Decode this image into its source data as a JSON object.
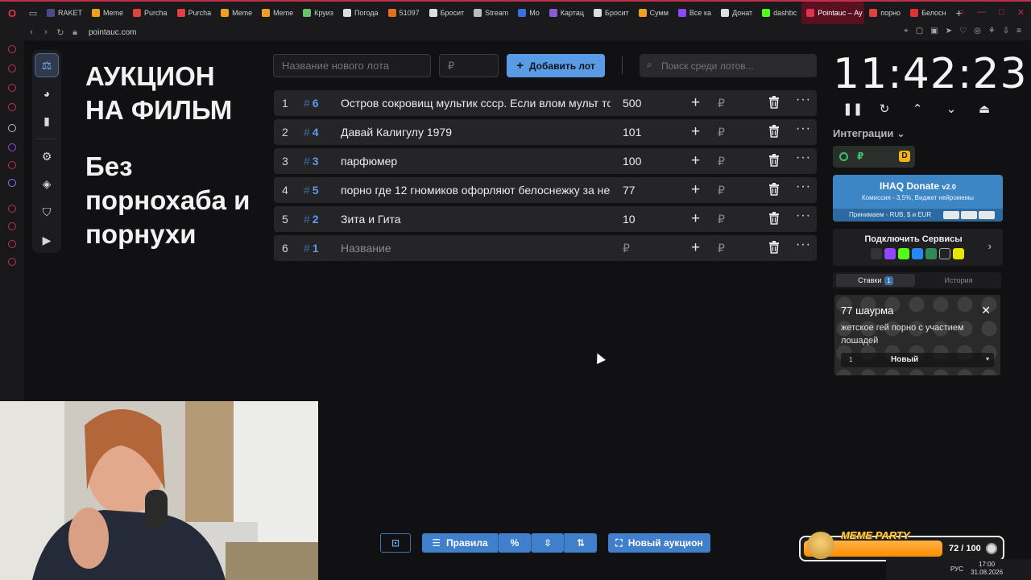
{
  "browser": {
    "tabs": [
      {
        "label": "RAKET",
        "color": "#4a4a8a"
      },
      {
        "label": "Meme",
        "color": "#f0a020"
      },
      {
        "label": "Purcha",
        "color": "#e04040"
      },
      {
        "label": "Purcha",
        "color": "#e04040"
      },
      {
        "label": "Meme",
        "color": "#f0a020"
      },
      {
        "label": "Meme",
        "color": "#f0a020"
      },
      {
        "label": "Круиз",
        "color": "#6ac06a"
      },
      {
        "label": "Погода",
        "color": "#ddd"
      },
      {
        "label": "51097",
        "color": "#e07020"
      },
      {
        "label": "Бросит",
        "color": "#ddd"
      },
      {
        "label": "Stream",
        "color": "#bbb"
      },
      {
        "label": "Мо",
        "color": "#3a6fe0"
      },
      {
        "label": "Картац",
        "color": "#8a5ad0"
      },
      {
        "label": "Бросит",
        "color": "#ddd"
      },
      {
        "label": "Сумм",
        "color": "#f0a020"
      },
      {
        "label": "Все ка",
        "color": "#9146ff"
      },
      {
        "label": "Донат",
        "color": "#ddd"
      },
      {
        "label": "dashbc",
        "color": "#53fc18"
      },
      {
        "label": "Pointauc – Ау",
        "color": "#e0334f",
        "active": true
      },
      {
        "label": "порно",
        "color": "#e04040"
      },
      {
        "label": "Белосн",
        "color": "#e03030"
      }
    ],
    "url": "pointauc.com"
  },
  "page": {
    "title": "АУКЦИОН НА ФИЛЬМ",
    "subtitle": "Без порнохаба и порнухи"
  },
  "form": {
    "lot_name_placeholder": "Название нового лота",
    "amount_placeholder": "₽",
    "add_button": "Добавить лот",
    "search_placeholder": "Поиск среди лотов..."
  },
  "lots": [
    {
      "num": "1",
      "id": "6",
      "name": "Остров сокровищ мультик ссср. Если влом мульт то",
      "amount": "500"
    },
    {
      "num": "2",
      "id": "4",
      "name": "Давай Калигулу 1979",
      "amount": "101"
    },
    {
      "num": "3",
      "id": "3",
      "name": "парфюмер",
      "amount": "100"
    },
    {
      "num": "4",
      "id": "5",
      "name": "порно где 12 гномиков офорляют белоснежку за не",
      "amount": "77"
    },
    {
      "num": "5",
      "id": "2",
      "name": "Зита и Гита",
      "amount": "10"
    },
    {
      "num": "6",
      "id": "1",
      "name": "Название",
      "amount": "₽",
      "placeholder": true
    }
  ],
  "lot_currency": "₽",
  "timer": "11:42:23",
  "integrations": {
    "label": "Интеграции",
    "chip_currency": "₽",
    "chip_icon_letter": "D"
  },
  "donate": {
    "name": "IHAQ Donate",
    "version": "v2.0",
    "line2": "Комиссия - 3,5%, Виджет нейромемы",
    "accepts": "Принимаем - RUB, $ и EUR"
  },
  "services": {
    "title": "Подключить Сервисы"
  },
  "bid_tabs": {
    "bets": "Ставки",
    "bets_count": "1",
    "history": "История"
  },
  "bid": {
    "amount": "77 шаурма",
    "message": "жетское гей порно с участием лошадей",
    "count": "1",
    "status": "Новый"
  },
  "bottom_bar": {
    "rules": "Правила",
    "new_auction": "Новый аукцион"
  },
  "widget": {
    "label": "MEME PARTY",
    "progress": "72 / 100"
  },
  "taskbar": {
    "lang": "РУС",
    "time": "17:00",
    "date": "31.08.2026"
  },
  "colors": {
    "accent": "#5a9be6",
    "opera": "#e0334f"
  }
}
